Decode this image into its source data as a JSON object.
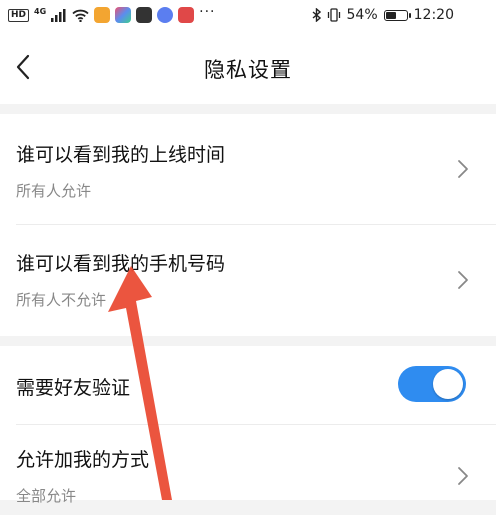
{
  "status_bar": {
    "network": "HD",
    "signal_type": "4G",
    "battery_percent": "54%",
    "battery_level": 0.54,
    "time": "12:20",
    "overflow": "···"
  },
  "header": {
    "title": "隐私设置"
  },
  "settings": {
    "online_time": {
      "title": "谁可以看到我的上线时间",
      "value": "所有人允许"
    },
    "phone_number": {
      "title": "谁可以看到我的手机号码",
      "value": "所有人不允许"
    },
    "friend_verify": {
      "title": "需要好友验证",
      "enabled": true
    },
    "add_method": {
      "title": "允许加我的方式",
      "value": "全部允许"
    }
  },
  "colors": {
    "accent": "#2f8cf0",
    "arrow": "#ea4c35",
    "background": "#f3f3f3",
    "secondary_text": "#888888"
  }
}
